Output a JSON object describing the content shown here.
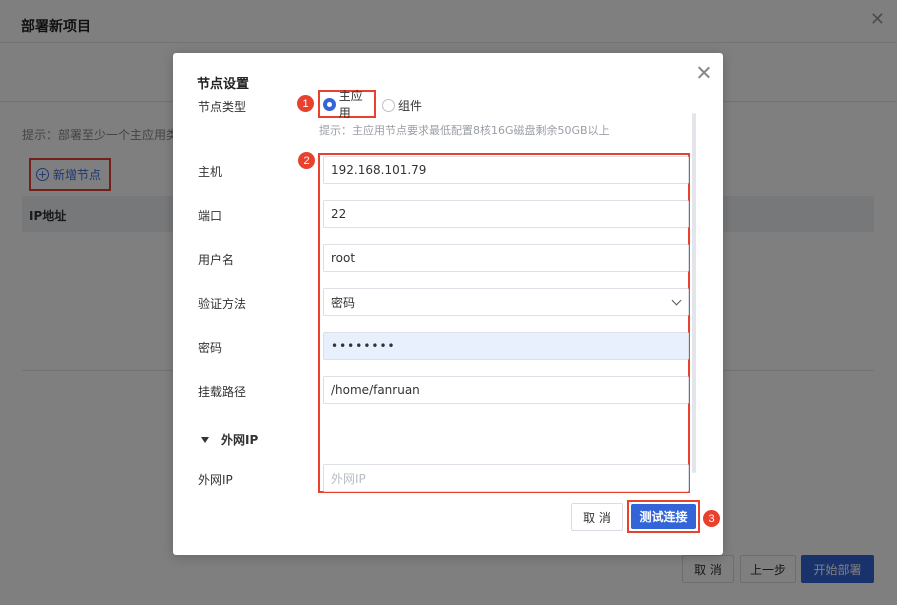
{
  "background": {
    "title": "部署新项目",
    "hint": "提示：部署至少一个主应用类",
    "add_node_label": "新增节点",
    "table_header": "IP地址",
    "footer": {
      "cancel": "取 消",
      "prev": "上一步",
      "start": "开始部署"
    }
  },
  "modal": {
    "title": "节点设置",
    "node_type_label": "节点类型",
    "node_type_options": [
      "主应用",
      "组件"
    ],
    "node_type_selected": "主应用",
    "tip": "提示：主应用节点要求最低配置8核16G磁盘剩余50GB以上",
    "fields": {
      "host_label": "主机",
      "host_value": "192.168.101.79",
      "port_label": "端口",
      "port_value": "22",
      "username_label": "用户名",
      "username_value": "root",
      "auth_label": "验证方法",
      "auth_value": "密码",
      "password_label": "密码",
      "password_value": "••••••••",
      "mount_label": "挂载路径",
      "mount_value": "/home/fanruan"
    },
    "external_section_label": "外网IP",
    "external_ip_label": "外网IP",
    "external_ip_placeholder": "外网IP",
    "cancel_label": "取 消",
    "test_label": "测试连接"
  },
  "steps": [
    "1",
    "2",
    "3"
  ],
  "colors": {
    "accent": "#3465d8",
    "highlight": "#e8412e"
  }
}
